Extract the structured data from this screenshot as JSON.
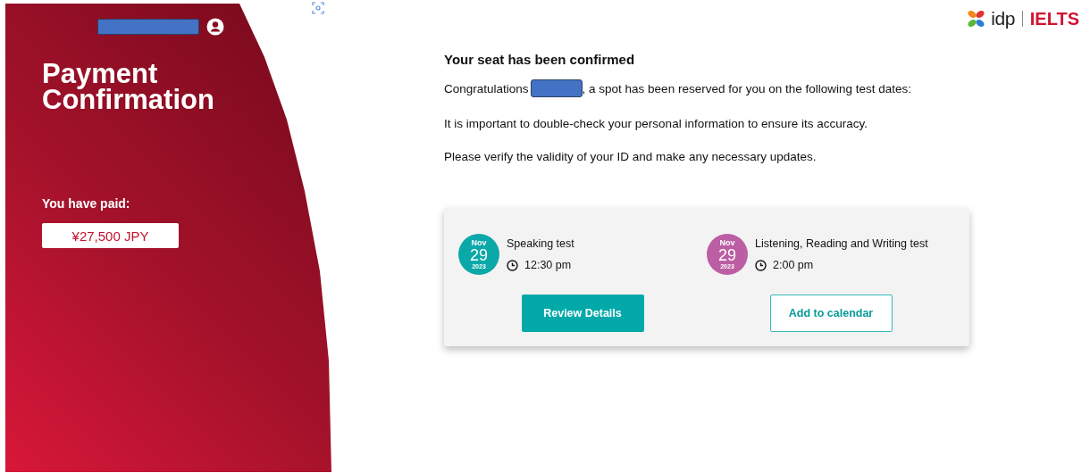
{
  "sidebar": {
    "title": "Payment Confirmation",
    "paid_label": "You have paid:",
    "amount": "¥27,500 JPY"
  },
  "logo": {
    "brand": "idp",
    "product": "IELTS"
  },
  "message": {
    "heading": "Your seat has been confirmed",
    "greeting_before": "Congratulations",
    "greeting_after": ", a spot has been reserved for you on the following test dates:",
    "paragraphs": [
      "It is important to double-check your personal information to ensure its accuracy.",
      "Please verify the validity of your ID and make any necessary updates."
    ]
  },
  "tests": [
    {
      "month": "Nov",
      "day": "29",
      "year": "2023",
      "color": "#0aa8a8",
      "name": "Speaking test",
      "time": "12:30 pm"
    },
    {
      "month": "Nov",
      "day": "29",
      "year": "2023",
      "color": "#bb5ea3",
      "name": "Listening, Reading and Writing test",
      "time": "2:00 pm"
    }
  ],
  "buttons": [
    {
      "label": "Review Details",
      "kind": "primary"
    },
    {
      "label": "Add to calendar",
      "kind": "outline"
    }
  ]
}
